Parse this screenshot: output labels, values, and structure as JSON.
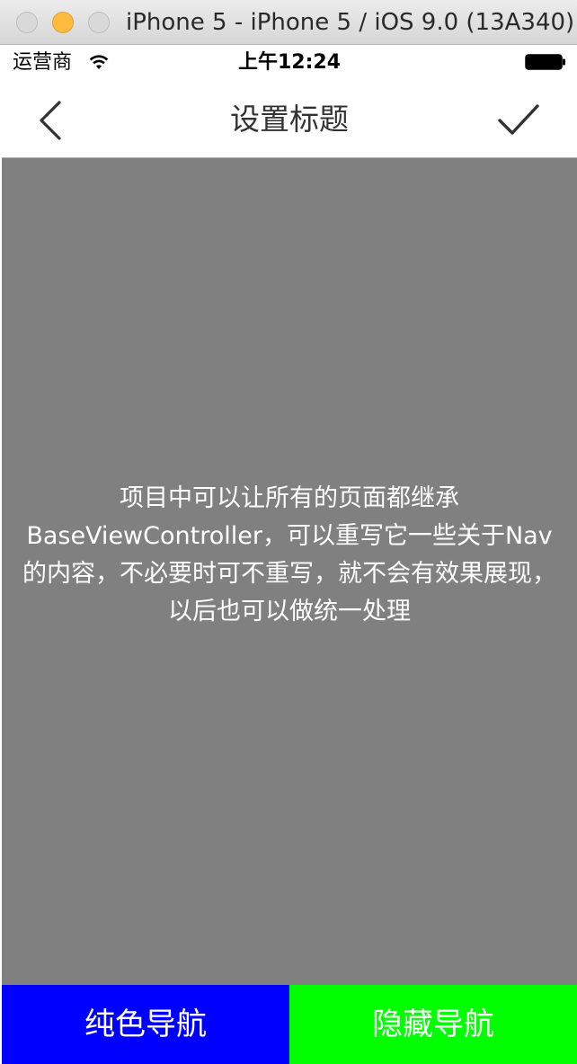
{
  "window": {
    "title": "iPhone 5 - iPhone 5 / iOS 9.0 (13A340)"
  },
  "status_bar": {
    "carrier": "运营商",
    "time": "上午12:24",
    "wifi_icon": "wifi-icon",
    "battery_icon": "battery-icon"
  },
  "nav_bar": {
    "title": "设置标题",
    "back_icon": "chevron-left-icon",
    "confirm_icon": "checkmark-icon"
  },
  "content": {
    "text": "项目中可以让所有的页面都继承BaseViewController，可以重写它一些关于Nav的内容，不必要时可不重写，就不会有效果展现，以后也可以做统一处理"
  },
  "bottom_buttons": {
    "solid_nav_label": "纯色导航",
    "hide_nav_label": "隐藏导航"
  },
  "colors": {
    "content_background": "#808080",
    "solid_button": "#0000ff",
    "hide_button": "#00ff00"
  }
}
